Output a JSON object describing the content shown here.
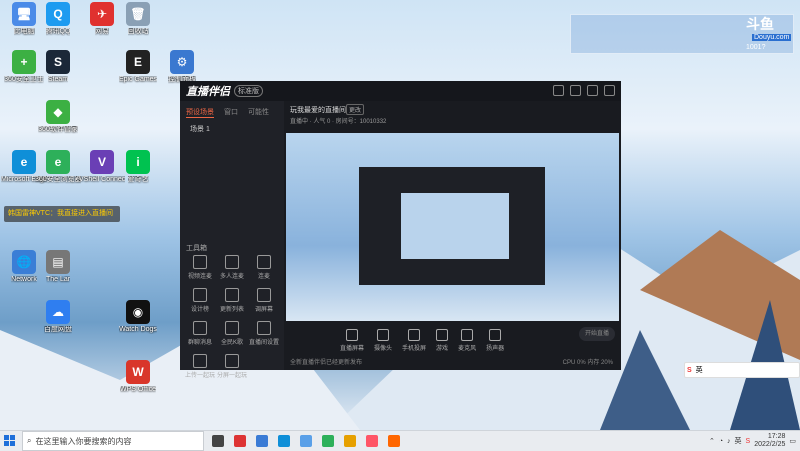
{
  "desktop_icons": [
    {
      "label": "此电脑",
      "color": "#4a8be8",
      "glyph": "🖥"
    },
    {
      "label": "腾讯QQ",
      "color": "#1d9bf0",
      "glyph": "Q"
    },
    {
      "label": "网易",
      "color": "#e0312f",
      "glyph": "✈"
    },
    {
      "label": "回收站",
      "color": "#8aa0b5",
      "glyph": "🗑"
    },
    {
      "label": "360安全卫士",
      "color": "#3cb043",
      "glyph": "+"
    },
    {
      "label": "Steam",
      "color": "#1b2838",
      "glyph": "S"
    },
    {
      "label": "Epic Games",
      "color": "#222",
      "glyph": "E"
    },
    {
      "label": "控制面板",
      "color": "#3a78d0",
      "glyph": "⚙"
    },
    {
      "label": "360软件管家",
      "color": "#3cb043",
      "glyph": "◆"
    },
    {
      "label": "Microsoft Edge",
      "color": "#0f8fd8",
      "glyph": "e"
    },
    {
      "label": "360安全浏览器",
      "color": "#2db05a",
      "glyph": "e"
    },
    {
      "label": "VShell Connect",
      "color": "#6a3fb5",
      "glyph": "V"
    },
    {
      "label": "爱奇艺",
      "color": "#00c250",
      "glyph": "i"
    },
    {
      "label": "百度网盘",
      "color": "#2f7ef0",
      "glyph": "☁"
    },
    {
      "label": "Watch Dogs",
      "color": "#111",
      "glyph": "◉"
    },
    {
      "label": "WPS Office",
      "color": "#d9362a",
      "glyph": "W"
    },
    {
      "label": "Network",
      "color": "#3a7ed6",
      "glyph": "🌐"
    },
    {
      "label": "The Lar",
      "color": "#777",
      "glyph": "▤"
    }
  ],
  "danmu_text": "韩国雷神VTC：我直接进入直播间",
  "watermark": {
    "logo": "斗鱼",
    "sub": "Douyu.com",
    "id": "1001?"
  },
  "app": {
    "brand": "直播伴侣",
    "badge": "标准版",
    "tabs": [
      "预设场景",
      "窗口",
      "可能性"
    ],
    "scene": "场景 1",
    "room_title": "玩我最爱的直播间",
    "room_chip": "更改",
    "room_meta": "直播中 · 人气 0 · 房间号：10010332",
    "tools_head": "工具箱",
    "tools": [
      "视频连麦",
      "多人连麦",
      "连麦",
      "设计榜",
      "更新列表",
      "调屏幕",
      "群聊消息",
      "全民K歌",
      "直播间设置",
      "上传一起玩",
      "分屏一起玩",
      ""
    ],
    "bottom": [
      "直播屏幕",
      "摄像头",
      "手机投屏",
      "游戏",
      "麦克风",
      "扬声器"
    ],
    "live_button": "开始直播",
    "status_left": "全新直播伴侣已经更新发布",
    "status_right": "CPU 0%  内存 20%"
  },
  "ime": {
    "label": "英"
  },
  "taskbar": {
    "search_placeholder": "在这里输入你要搜索的内容",
    "time": "17:28",
    "date": "2022/2/25",
    "lang": "英"
  }
}
